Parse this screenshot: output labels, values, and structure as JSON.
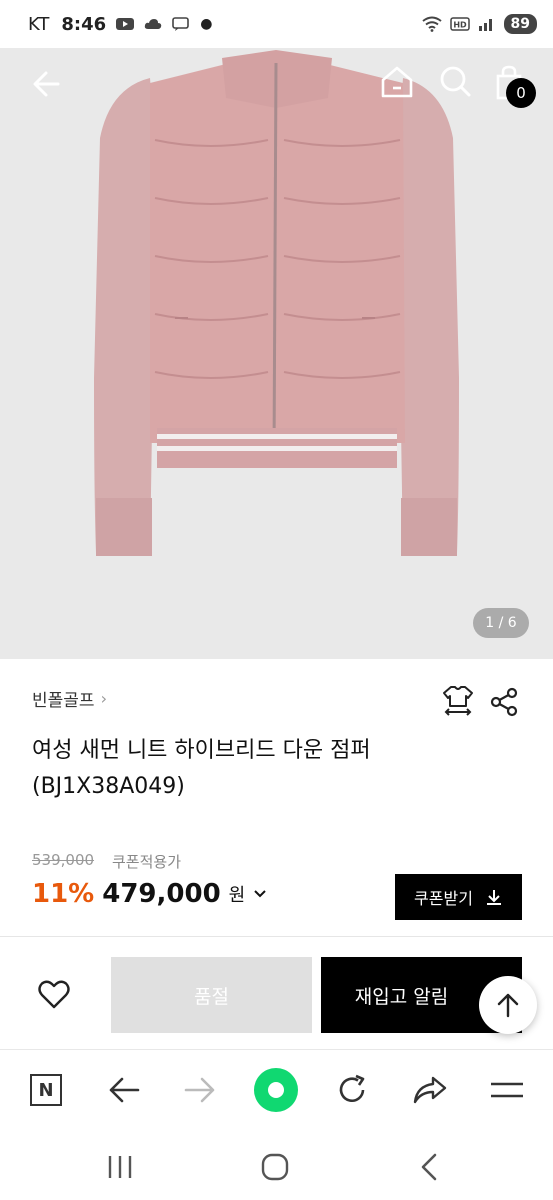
{
  "status_bar": {
    "carrier": "KT",
    "time": "8:46",
    "battery": "89"
  },
  "hero": {
    "pager": "1 / 6",
    "cart_count": "0",
    "jacket_colors": {
      "body": "#d9a7a7",
      "sleeve": "#d5adae",
      "stripe": "#f2eeee"
    }
  },
  "product": {
    "brand": "빈폴골프",
    "title": "여성 새먼 니트 하이브리드 다운 점퍼 (BJ1X38A049)",
    "original_price": "539,000",
    "coupon_note": "쿠폰적용가",
    "discount": "11%",
    "price": "479,000",
    "currency": "원",
    "coupon_button": "쿠폰받기"
  },
  "actions": {
    "soldout": "품절",
    "restock": "재입고 알림"
  },
  "colors": {
    "accent_discount": "#e8590c",
    "browser_green": "#10d871"
  }
}
